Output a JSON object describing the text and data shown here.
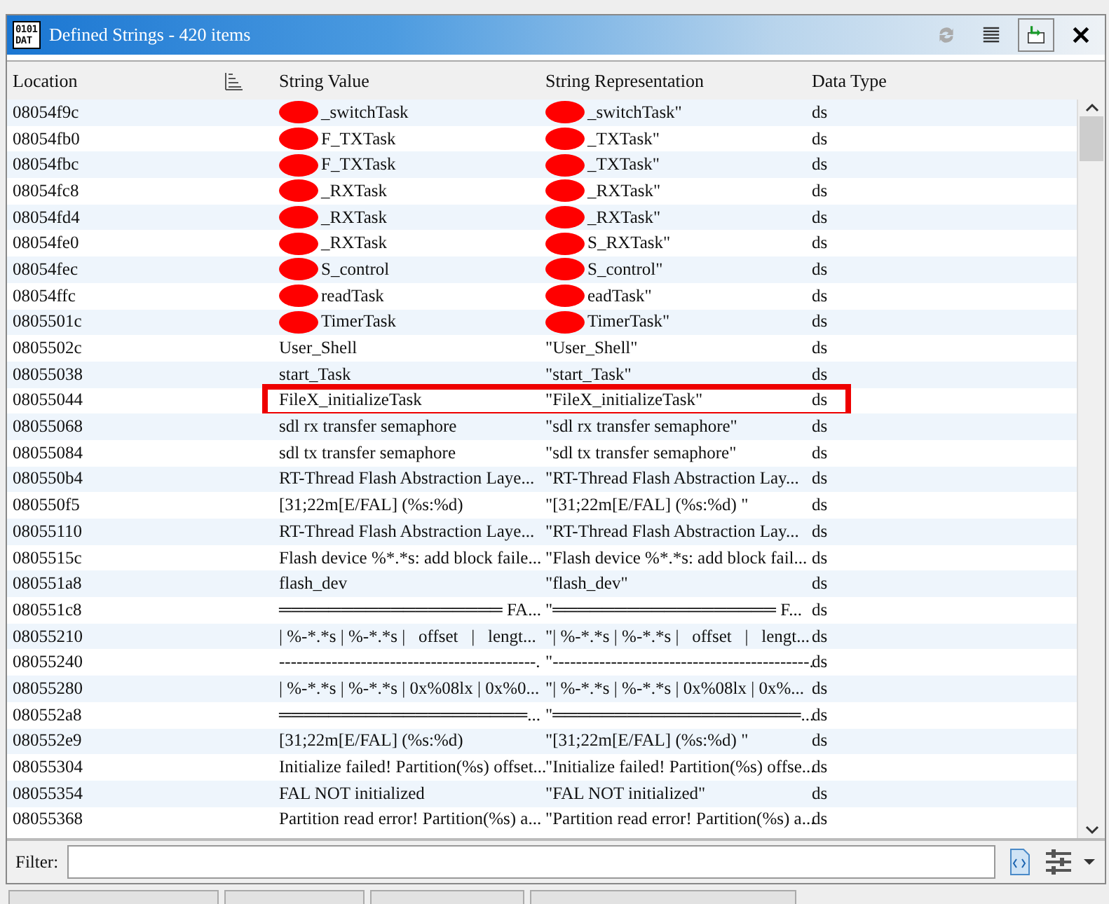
{
  "window": {
    "title": "Defined Strings - 420 items",
    "icon_text": "0101 DAT"
  },
  "table": {
    "columns": [
      "Location",
      "String Value",
      "String Representation",
      "Data Type"
    ],
    "rows": [
      {
        "location": "08054f9c",
        "value": "_switchTask",
        "representation": "_switchTask\"",
        "type": "ds",
        "redacted": true,
        "highlighted": false
      },
      {
        "location": "08054fb0",
        "value": "F_TXTask",
        "representation": "_TXTask\"",
        "type": "ds",
        "redacted": true,
        "highlighted": false
      },
      {
        "location": "08054fbc",
        "value": "F_TXTask",
        "representation": "_TXTask\"",
        "type": "ds",
        "redacted": true,
        "highlighted": false
      },
      {
        "location": "08054fc8",
        "value": "_RXTask",
        "representation": "_RXTask\"",
        "type": "ds",
        "redacted": true,
        "highlighted": false
      },
      {
        "location": "08054fd4",
        "value": "_RXTask",
        "representation": "_RXTask\"",
        "type": "ds",
        "redacted": true,
        "highlighted": false
      },
      {
        "location": "08054fe0",
        "value": "_RXTask",
        "representation": "S_RXTask\"",
        "type": "ds",
        "redacted": true,
        "highlighted": false
      },
      {
        "location": "08054fec",
        "value": "S_control",
        "representation": "S_control\"",
        "type": "ds",
        "redacted": true,
        "highlighted": false
      },
      {
        "location": "08054ffc",
        "value": "readTask",
        "representation": "eadTask\"",
        "type": "ds",
        "redacted": true,
        "highlighted": false
      },
      {
        "location": "0805501c",
        "value": "TimerTask",
        "representation": "TimerTask\"",
        "type": "ds",
        "redacted": true,
        "highlighted": false
      },
      {
        "location": "0805502c",
        "value": "User_Shell",
        "representation": "\"User_Shell\"",
        "type": "ds",
        "redacted": false,
        "highlighted": false
      },
      {
        "location": "08055038",
        "value": "start_Task",
        "representation": "\"start_Task\"",
        "type": "ds",
        "redacted": false,
        "highlighted": false
      },
      {
        "location": "08055044",
        "value": "FileX_initializeTask",
        "representation": "\"FileX_initializeTask\"",
        "type": "ds",
        "redacted": false,
        "highlighted": true
      },
      {
        "location": "08055068",
        "value": "sdl rx transfer semaphore",
        "representation": "\"sdl rx transfer semaphore\"",
        "type": "ds",
        "redacted": false,
        "highlighted": false
      },
      {
        "location": "08055084",
        "value": "sdl tx transfer semaphore",
        "representation": "\"sdl tx transfer semaphore\"",
        "type": "ds",
        "redacted": false,
        "highlighted": false
      },
      {
        "location": "080550b4",
        "value": "RT-Thread Flash Abstraction Laye...",
        "representation": "\"RT-Thread Flash Abstraction Lay...",
        "type": "ds",
        "redacted": false,
        "highlighted": false
      },
      {
        "location": "080550f5",
        "value": "[31;22m[E/FAL] (%s:%d)",
        "representation": "\"[31;22m[E/FAL] (%s:%d) \"",
        "type": "ds",
        "redacted": false,
        "highlighted": false
      },
      {
        "location": "08055110",
        "value": "RT-Thread Flash Abstraction Laye...",
        "representation": "\"RT-Thread Flash Abstraction Lay...",
        "type": "ds",
        "redacted": false,
        "highlighted": false
      },
      {
        "location": "0805515c",
        "value": "Flash device %*.*s: add block faile...",
        "representation": "\"Flash device %*.*s: add block fail...",
        "type": "ds",
        "redacted": false,
        "highlighted": false
      },
      {
        "location": "080551a8",
        "value": "flash_dev",
        "representation": "\"flash_dev\"",
        "type": "ds",
        "redacted": false,
        "highlighted": false
      },
      {
        "location": "080551c8",
        "value": "══════════════════ FA...",
        "representation": "\"══════════════════ F...",
        "type": "ds",
        "redacted": false,
        "highlighted": false
      },
      {
        "location": "08055210",
        "value": "| %-*.*s | %-*.*s |   offset   |   lengt...",
        "representation": "\"| %-*.*s | %-*.*s |   offset   |   lengt...",
        "type": "ds",
        "redacted": false,
        "highlighted": false
      },
      {
        "location": "08055240",
        "value": "--------------------------------------------.",
        "representation": "\"--------------------------------------------.",
        "type": "ds",
        "redacted": false,
        "highlighted": false
      },
      {
        "location": "08055280",
        "value": "| %-*.*s | %-*.*s | 0x%08lx | 0x%0...",
        "representation": "\"| %-*.*s | %-*.*s | 0x%08lx | 0x%...",
        "type": "ds",
        "redacted": false,
        "highlighted": false
      },
      {
        "location": "080552a8",
        "value": "════════════════════...",
        "representation": "\"════════════════════...",
        "type": "ds",
        "redacted": false,
        "highlighted": false
      },
      {
        "location": "080552e9",
        "value": "[31;22m[E/FAL] (%s:%d)",
        "representation": "\"[31;22m[E/FAL] (%s:%d) \"",
        "type": "ds",
        "redacted": false,
        "highlighted": false
      },
      {
        "location": "08055304",
        "value": "Initialize failed! Partition(%s) offset...",
        "representation": "\"Initialize failed! Partition(%s) offse...",
        "type": "ds",
        "redacted": false,
        "highlighted": false
      },
      {
        "location": "08055354",
        "value": "FAL NOT initialized",
        "representation": "\"FAL NOT initialized\"",
        "type": "ds",
        "redacted": false,
        "highlighted": false
      },
      {
        "location": "08055368",
        "value": "Partition read error! Partition(%s) a...",
        "representation": "\"Partition read error! Partition(%s) a...",
        "type": "ds",
        "redacted": false,
        "highlighted": false
      }
    ]
  },
  "filter": {
    "label": "Filter:"
  }
}
